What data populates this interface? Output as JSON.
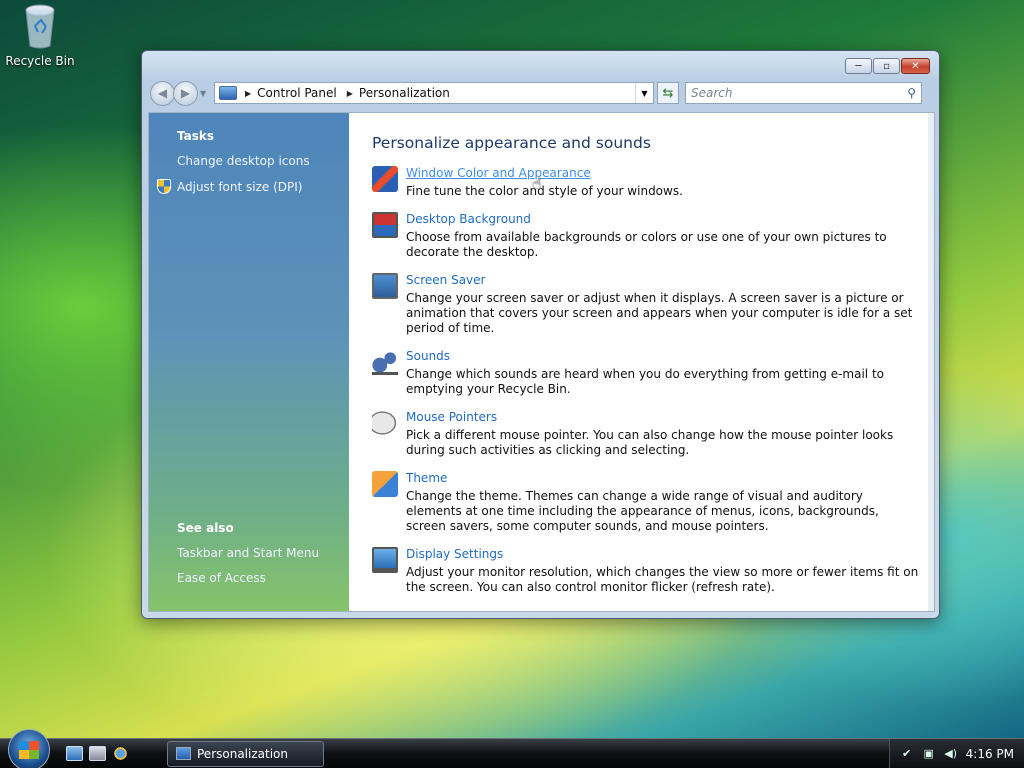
{
  "desktop": {
    "recycle_bin": "Recycle Bin"
  },
  "window": {
    "minimize": "─",
    "maximize": "▫",
    "close": "✕"
  },
  "address": {
    "crumbs": [
      "Control Panel",
      "Personalization"
    ],
    "search_placeholder": "Search"
  },
  "sidebar": {
    "tasks_header": "Tasks",
    "tasks": [
      "Change desktop icons",
      "Adjust font size (DPI)"
    ],
    "see_also_header": "See also",
    "see_also": [
      "Taskbar and Start Menu",
      "Ease of Access"
    ]
  },
  "main": {
    "title": "Personalize appearance and sounds",
    "items": [
      {
        "link": "Window Color and Appearance",
        "desc": "Fine tune the color and style of your windows.",
        "icon": "window-color-icon"
      },
      {
        "link": "Desktop Background",
        "desc": "Choose from available backgrounds or colors or use one of your own pictures to decorate the desktop.",
        "icon": "desktop-background-icon"
      },
      {
        "link": "Screen Saver",
        "desc": "Change your screen saver or adjust when it displays. A screen saver is a picture or animation that covers your screen and appears when your computer is idle for a set period of time.",
        "icon": "screen-saver-icon"
      },
      {
        "link": "Sounds",
        "desc": "Change which sounds are heard when you do everything from getting e-mail to emptying your Recycle Bin.",
        "icon": "sounds-icon"
      },
      {
        "link": "Mouse Pointers",
        "desc": "Pick a different mouse pointer. You can also change how the mouse pointer looks during such activities as clicking and selecting.",
        "icon": "mouse-pointer-icon"
      },
      {
        "link": "Theme",
        "desc": "Change the theme. Themes can change a wide range of visual and auditory elements at one time including the appearance of menus, icons, backgrounds, screen savers, some computer sounds, and mouse pointers.",
        "icon": "theme-icon"
      },
      {
        "link": "Display Settings",
        "desc": "Adjust your monitor resolution, which changes the view so more or fewer items fit on the screen. You can also control monitor flicker (refresh rate).",
        "icon": "display-settings-icon"
      }
    ]
  },
  "taskbar": {
    "task_button": "Personalization",
    "clock": "4:16 PM"
  }
}
